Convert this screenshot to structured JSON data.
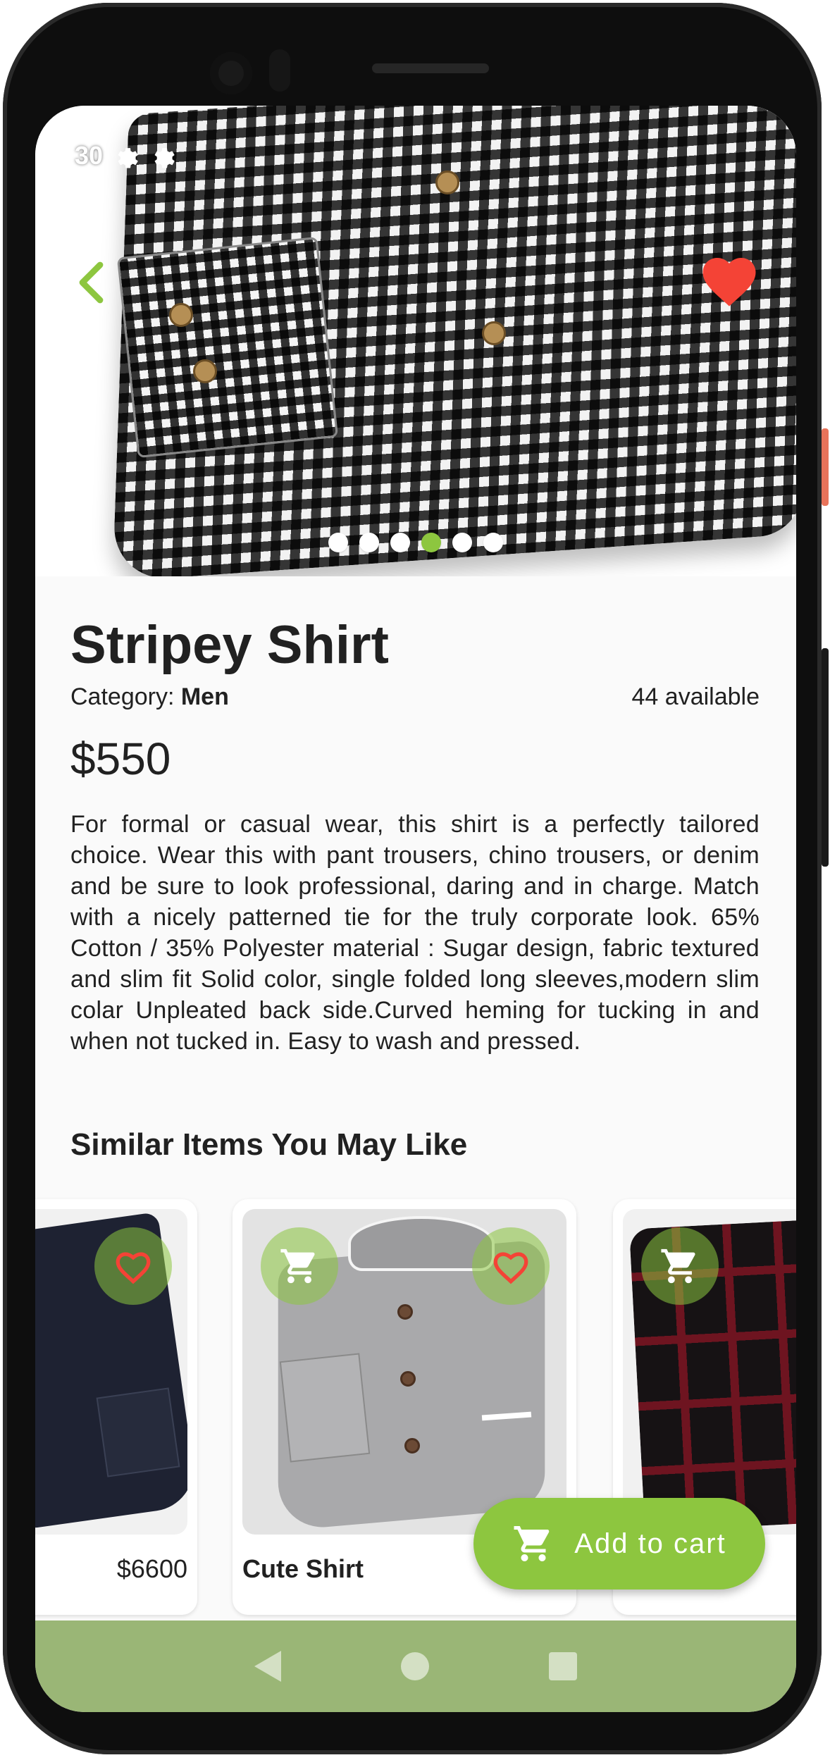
{
  "status_bar": {
    "time": "30"
  },
  "product": {
    "title": "Stripey Shirt",
    "category_label": "Category: ",
    "category_value": "Men",
    "availability": "44 available",
    "price": "$550",
    "description": "For formal or casual wear, this shirt is a perfectly tailored choice. Wear this with pant trousers, chino trousers, or denim and be sure to look professional, daring and in charge. Match with a nicely patterned tie for the truly corporate look.  65% Cotton / 35% Polyester  material : Sugar design, fabric textured and slim fit  Solid color, single folded long sleeves,modern slim colar  Unpleated back side.Curved heming for tucking in and when not tucked in.  Easy to wash and pressed.",
    "favorite": true
  },
  "carousel": {
    "count": 6,
    "active_index": 3
  },
  "similar": {
    "heading": "Similar Items You May Like",
    "items": [
      {
        "name": "",
        "price": "$6600"
      },
      {
        "name": "Cute Shirt",
        "price": ""
      },
      {
        "name": "",
        "price": ""
      }
    ]
  },
  "actions": {
    "add_to_cart_label": "Add to cart"
  },
  "colors": {
    "accent": "#8dc63f",
    "heart": "#f44336",
    "nav_bar": "#9ab676"
  },
  "icons": [
    "gear-icon",
    "back-arrow-icon",
    "heart-icon",
    "heart-outline-icon",
    "cart-icon",
    "nav-back-icon",
    "nav-home-icon",
    "nav-recents-icon"
  ]
}
